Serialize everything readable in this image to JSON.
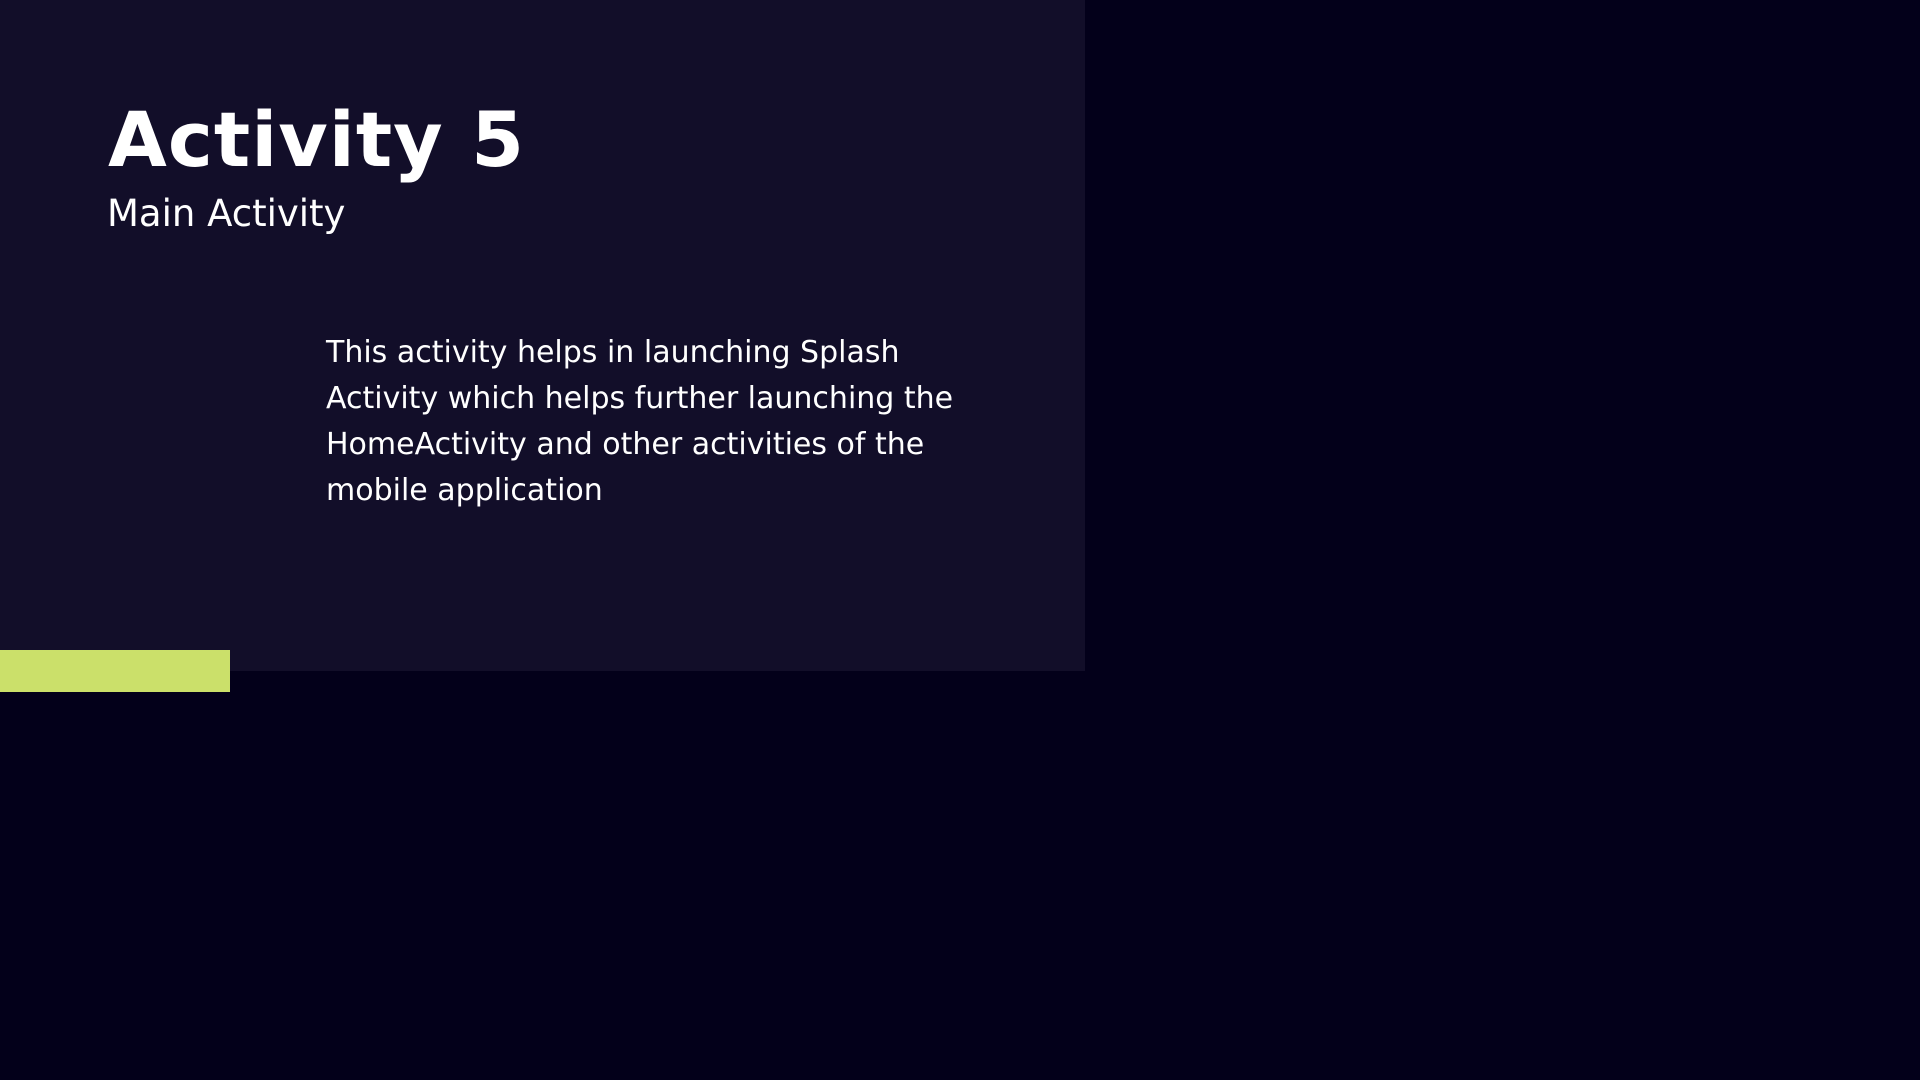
{
  "slide": {
    "title": "Activity 5",
    "subtitle": "Main Activity",
    "body": "This activity helps in launching Splash Activity which helps further launching the HomeActivity and other activities of the mobile application"
  },
  "colors": {
    "background": "#03001a",
    "panel": "#120e29",
    "accent": "#cbe06a",
    "text": "#ffffff"
  }
}
